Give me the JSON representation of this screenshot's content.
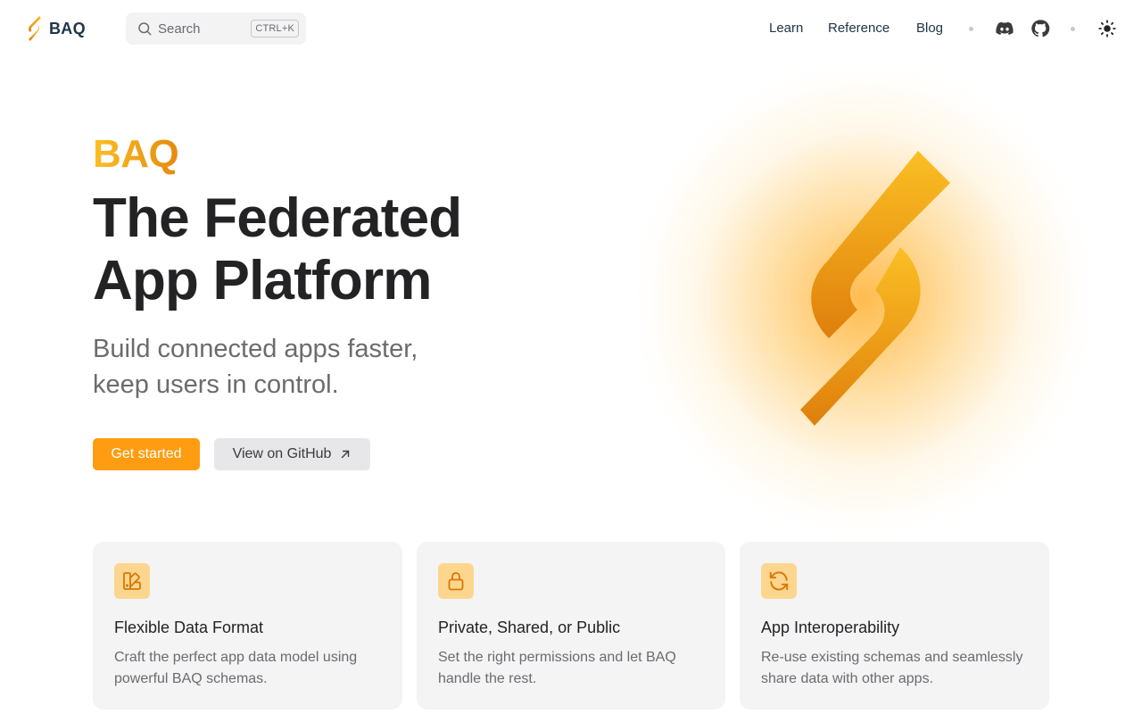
{
  "nav": {
    "brand": "BAQ",
    "search": {
      "label": "Search",
      "shortcut": "CTRL+K"
    },
    "links": [
      {
        "label": "Learn"
      },
      {
        "label": "Reference"
      },
      {
        "label": "Blog"
      }
    ],
    "icons": [
      "discord-icon",
      "github-icon",
      "sun-icon"
    ]
  },
  "hero": {
    "name": "BAQ",
    "title_line1": "The Federated",
    "title_line2": "App Platform",
    "tagline_line1": "Build connected apps faster,",
    "tagline_line2": "keep users in control.",
    "primary_action": "Get started",
    "secondary_action": "View on GitHub"
  },
  "features": [
    {
      "icon": "swatch-book-icon",
      "title": "Flexible Data Format",
      "details": "Craft the perfect app data model using powerful BAQ schemas."
    },
    {
      "icon": "lock-icon",
      "title": "Private, Shared, or Public",
      "details": "Set the right permissions and let BAQ handle the rest."
    },
    {
      "icon": "refresh-icon",
      "title": "App Interoperability",
      "details": "Re-use existing schemas and seamlessly share data with other apps."
    }
  ],
  "colors": {
    "brand_orange": "#ff9c12",
    "brand_gradient_start": "#fbbf24",
    "brand_gradient_end": "#e58a0e",
    "card_background": "#f4f4f5",
    "icon_background": "#fcd68e",
    "heading_text": "#232325",
    "muted_text": "#6b6b70"
  }
}
